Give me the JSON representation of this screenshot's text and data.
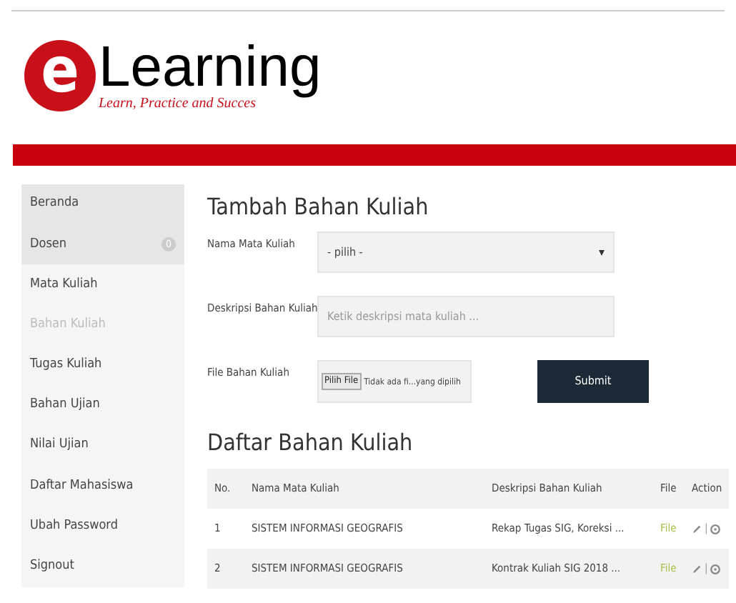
{
  "logo": {
    "letter": "e",
    "word": "Learning",
    "tagline": "Learn, Practice and Succes"
  },
  "sidebar": {
    "items": [
      {
        "label": "Beranda",
        "selected": false,
        "shaded": true
      },
      {
        "label": "Dosen",
        "selected": false,
        "shaded": true,
        "badge": "0"
      },
      {
        "label": "Mata Kuliah",
        "selected": false,
        "shaded": false
      },
      {
        "label": "Bahan Kuliah",
        "selected": true,
        "shaded": false
      },
      {
        "label": "Tugas Kuliah",
        "selected": false,
        "shaded": false
      },
      {
        "label": "Bahan Ujian",
        "selected": false,
        "shaded": false
      },
      {
        "label": "Nilai Ujian",
        "selected": false,
        "shaded": false
      },
      {
        "label": "Daftar Mahasiswa",
        "selected": false,
        "shaded": false
      },
      {
        "label": "Ubah Password",
        "selected": false,
        "shaded": false
      },
      {
        "label": "Signout",
        "selected": false,
        "shaded": false
      }
    ]
  },
  "form": {
    "title": "Tambah Bahan Kuliah",
    "fields": [
      {
        "kind": "select",
        "label": "Nama Mata Kuliah",
        "value": "- pilih -"
      },
      {
        "kind": "text",
        "label": "Deskripsi Bahan Kuliah",
        "placeholder": "Ketik deskripsi mata kuliah ..."
      },
      {
        "kind": "file",
        "label": "File Bahan Kuliah",
        "button": "Pilih File",
        "status": "Tidak ada fi...yang dipilih"
      }
    ],
    "submit": "Submit"
  },
  "table": {
    "title": "Daftar Bahan Kuliah",
    "columns": [
      "No.",
      "Nama Mata Kuliah",
      "Deskripsi Bahan Kuliah",
      "File",
      "Action"
    ],
    "rows": [
      {
        "no": "1",
        "name": "SISTEM INFORMASI GEOGRAFIS",
        "description": "Rekap Tugas SIG, Koreksi ...",
        "file": "File",
        "separator": "|"
      },
      {
        "no": "2",
        "name": "SISTEM INFORMASI GEOGRAFIS",
        "description": "Kontrak Kuliah SIG 2018 ...",
        "file": "File",
        "separator": "|"
      }
    ]
  }
}
